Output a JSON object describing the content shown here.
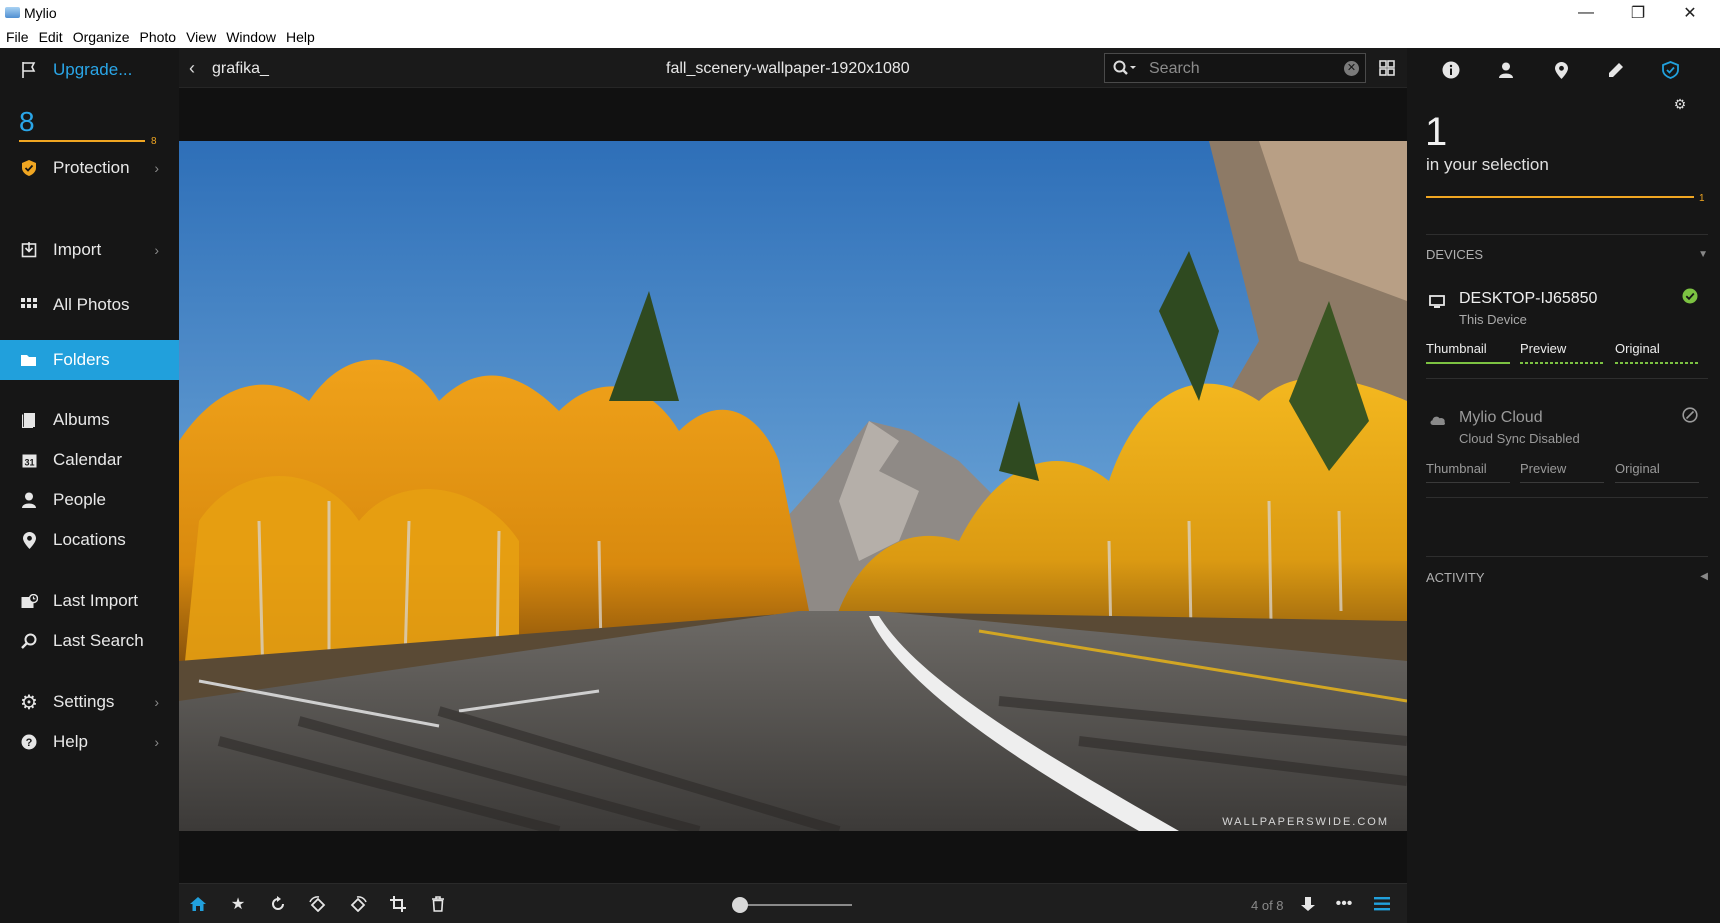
{
  "window": {
    "title": "Mylio",
    "minimize": "—",
    "maximize": "❐",
    "close": "✕"
  },
  "menu": [
    "File",
    "Edit",
    "Organize",
    "Photo",
    "View",
    "Window",
    "Help"
  ],
  "sidebar": {
    "upgrade": "Upgrade...",
    "photo_count": "8",
    "photo_count_bar_label": "8",
    "items": [
      {
        "label": "Protection",
        "icon": "shield-icon"
      },
      {
        "label": "Import",
        "icon": "import-icon"
      },
      {
        "label": "All Photos",
        "icon": "grid-icon"
      },
      {
        "label": "Folders",
        "icon": "folder-icon"
      },
      {
        "label": "Albums",
        "icon": "albums-icon"
      },
      {
        "label": "Calendar",
        "icon": "calendar-icon"
      },
      {
        "label": "People",
        "icon": "person-icon"
      },
      {
        "label": "Locations",
        "icon": "location-pin-icon"
      },
      {
        "label": "Last Import",
        "icon": "last-import-icon"
      },
      {
        "label": "Last Search",
        "icon": "search-icon"
      },
      {
        "label": "Settings",
        "icon": "gear-icon"
      },
      {
        "label": "Help",
        "icon": "help-icon"
      }
    ]
  },
  "topbar": {
    "folder": "grafika_",
    "filename": "fall_scenery-wallpaper-1920x1080",
    "search_placeholder": "Search"
  },
  "photo": {
    "watermark": "WALLPAPERSWIDE.COM"
  },
  "bottombar": {
    "page": "4 of 8",
    "zoom_fraction": 0.0
  },
  "right_panel": {
    "selection_count": "1",
    "selection_label": "in your selection",
    "selection_bar_label": "1",
    "devices_title": "DEVICES",
    "devices": [
      {
        "name": "DESKTOP-IJ65850",
        "subtitle": "This Device",
        "status": "synced",
        "tiers": [
          "Thumbnail",
          "Preview",
          "Original"
        ]
      },
      {
        "name": "Mylio Cloud",
        "subtitle": "Cloud Sync Disabled",
        "status": "disabled",
        "tiers": [
          "Thumbnail",
          "Preview",
          "Original"
        ]
      }
    ],
    "activity_title": "ACTIVITY"
  },
  "colors": {
    "accent": "#21a0dc",
    "orange": "#f0a622",
    "green": "#7cc242"
  }
}
